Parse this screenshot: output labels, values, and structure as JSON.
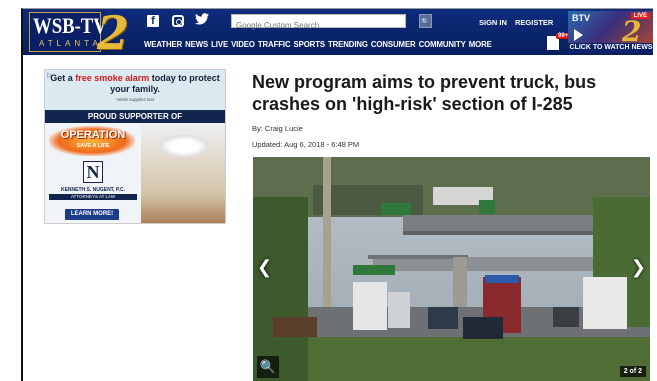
{
  "header": {
    "logo_text": "WSB-TV",
    "logo_sub": "ATLANTA",
    "logo_number": "2",
    "social": {
      "facebook": "f",
      "twitter": "🐦"
    },
    "search_placeholder": "Google Custom Search",
    "search_button": "🔍",
    "signin": "SIGN IN",
    "register": "REGISTER",
    "notification_count": "99+",
    "nav": [
      "WEATHER",
      "NEWS",
      "LIVE",
      "VIDEO",
      "TRAFFIC",
      "SPORTS",
      "TRENDING",
      "CONSUMER",
      "COMMUNITY",
      "MORE"
    ],
    "live": {
      "brand": "BTV",
      "badge": "LIVE",
      "number": "2",
      "cta": "CLICK TO WATCH NEWS"
    }
  },
  "ad": {
    "headline_pre": "Get a ",
    "headline_red": "free smoke alarm",
    "headline_post": " today to protect your family.",
    "note": "*while supplies last",
    "band": "PROUD SUPPORTER OF",
    "operation": "OPERATION",
    "operation_sub": "SAVE A LIFE",
    "logo_letter": "N",
    "firm": "KENNETH S. NUGENT, P.C.",
    "firm_sub": "ATTORNEYS AT LAW",
    "learn_more": "LEARN MORE!"
  },
  "article": {
    "headline": "New program aims to prevent truck, bus crashes on 'high-risk' section of I-285",
    "byline": "By: Craig Lucie",
    "updated": "Updated: Aug 6, 2018 - 6:48 PM",
    "photo_counter": "2 of 2"
  },
  "colors": {
    "header_bg": "#0d2c7c",
    "accent_gold": "#e6b93a",
    "live_red": "#e02020",
    "ad_red": "#d41b1b"
  }
}
